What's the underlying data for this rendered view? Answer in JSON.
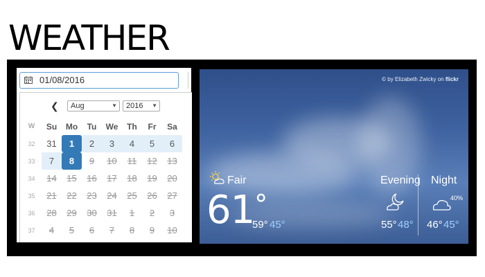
{
  "page": {
    "title": "WEATHER"
  },
  "datepicker": {
    "value": "01/08/2016",
    "month": "Aug",
    "year": "2016",
    "weekday_headers": [
      "W",
      "Su",
      "Mo",
      "Tu",
      "We",
      "Th",
      "Fr",
      "Sa"
    ],
    "weeks": [
      {
        "week": "32",
        "days": [
          "31",
          "1",
          "2",
          "3",
          "4",
          "5",
          "6"
        ]
      },
      {
        "week": "33",
        "days": [
          "7",
          "8",
          "9",
          "10",
          "11",
          "12",
          "13"
        ]
      },
      {
        "week": "34",
        "days": [
          "14",
          "15",
          "16",
          "17",
          "18",
          "19",
          "20"
        ]
      },
      {
        "week": "35",
        "days": [
          "21",
          "22",
          "23",
          "24",
          "25",
          "26",
          "27"
        ]
      },
      {
        "week": "36",
        "days": [
          "28",
          "29",
          "30",
          "31",
          "1",
          "2",
          "3"
        ]
      },
      {
        "week": "37",
        "days": [
          "4",
          "5",
          "6",
          "7",
          "8",
          "9",
          "10"
        ]
      }
    ],
    "accent_color": "#337ab7"
  },
  "weather": {
    "credit_prefix": "© by Elizabeth Zwicky on",
    "credit_brand": "flickr",
    "current": {
      "condition": "Fair",
      "temp": "61",
      "degree": "°",
      "high": "59°",
      "low": "45°",
      "icon": "partly-sunny-icon"
    },
    "evening": {
      "label": "Evening",
      "high": "55°",
      "low": "48°",
      "icon": "moon-cloud-icon"
    },
    "night": {
      "label": "Night",
      "precip": "40%",
      "high": "46°",
      "low": "45°",
      "icon": "cloud-icon"
    },
    "low_color": "#9fd0ff"
  }
}
